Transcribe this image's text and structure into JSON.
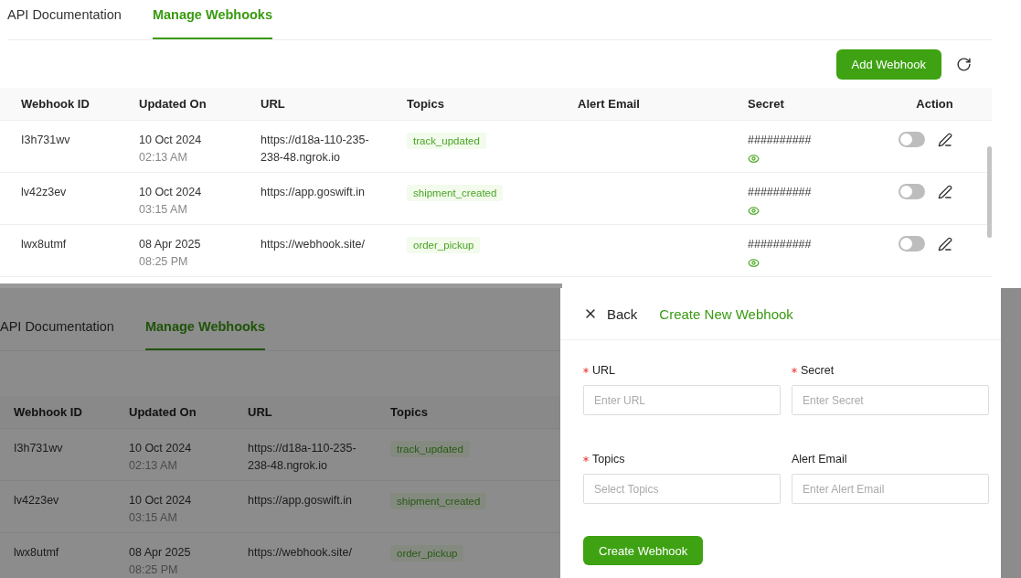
{
  "top_screen": {
    "tabs": [
      {
        "label": "API Documentation",
        "selected": false
      },
      {
        "label": "Manage Webhooks",
        "selected": true
      }
    ],
    "add_button": "Add Webhook",
    "table": {
      "columns": [
        "Webhook ID",
        "Updated On",
        "URL",
        "Topics",
        "Alert Email",
        "Secret",
        "Action"
      ],
      "rows": [
        {
          "id": "I3h731wv",
          "date": "10 Oct 2024",
          "time": "02:13 AM",
          "url": "https://d18a-110-235-238-48.ngrok.io",
          "topic": "track_updated",
          "secret": "##########",
          "enabled": false
        },
        {
          "id": "lv42z3ev",
          "date": "10 Oct 2024",
          "time": "03:15 AM",
          "url": "https://app.goswift.in",
          "topic": "shipment_created",
          "secret": "##########",
          "enabled": false
        },
        {
          "id": "lwx8utmf",
          "date": "08 Apr 2025",
          "time": "08:25 PM",
          "url": "https://webhook.site/",
          "topic": "order_pickup",
          "secret": "##########",
          "enabled": false
        }
      ]
    }
  },
  "bottom_screen": {
    "tabs": [
      {
        "label": "API Documentation",
        "selected": false
      },
      {
        "label": "Manage Webhooks",
        "selected": true
      }
    ],
    "table": {
      "columns": [
        "Webhook ID",
        "Updated On",
        "URL",
        "Topics"
      ],
      "rows": [
        {
          "id": "I3h731wv",
          "date": "10 Oct 2024",
          "time": "02:13 AM",
          "url": "https://d18a-110-235-238-48.ngrok.io",
          "topic": "track_updated"
        },
        {
          "id": "lv42z3ev",
          "date": "10 Oct 2024",
          "time": "03:15 AM",
          "url": "https://app.goswift.in",
          "topic": "shipment_created"
        },
        {
          "id": "lwx8utmf",
          "date": "08 Apr 2025",
          "time": "08:25 PM",
          "url": "https://webhook.site/",
          "topic": "order_pickup"
        }
      ]
    },
    "drawer": {
      "back": "Back",
      "title": "Create New Webhook",
      "fields": [
        {
          "label": "URL",
          "required": true,
          "placeholder": "Enter URL"
        },
        {
          "label": "Secret",
          "required": true,
          "placeholder": "Enter Secret"
        },
        {
          "label": "Topics",
          "required": true,
          "placeholder": "Select Topics"
        },
        {
          "label": "Alert Email",
          "required": false,
          "placeholder": "Enter Alert Email"
        }
      ],
      "submit": "Create Webhook"
    }
  }
}
